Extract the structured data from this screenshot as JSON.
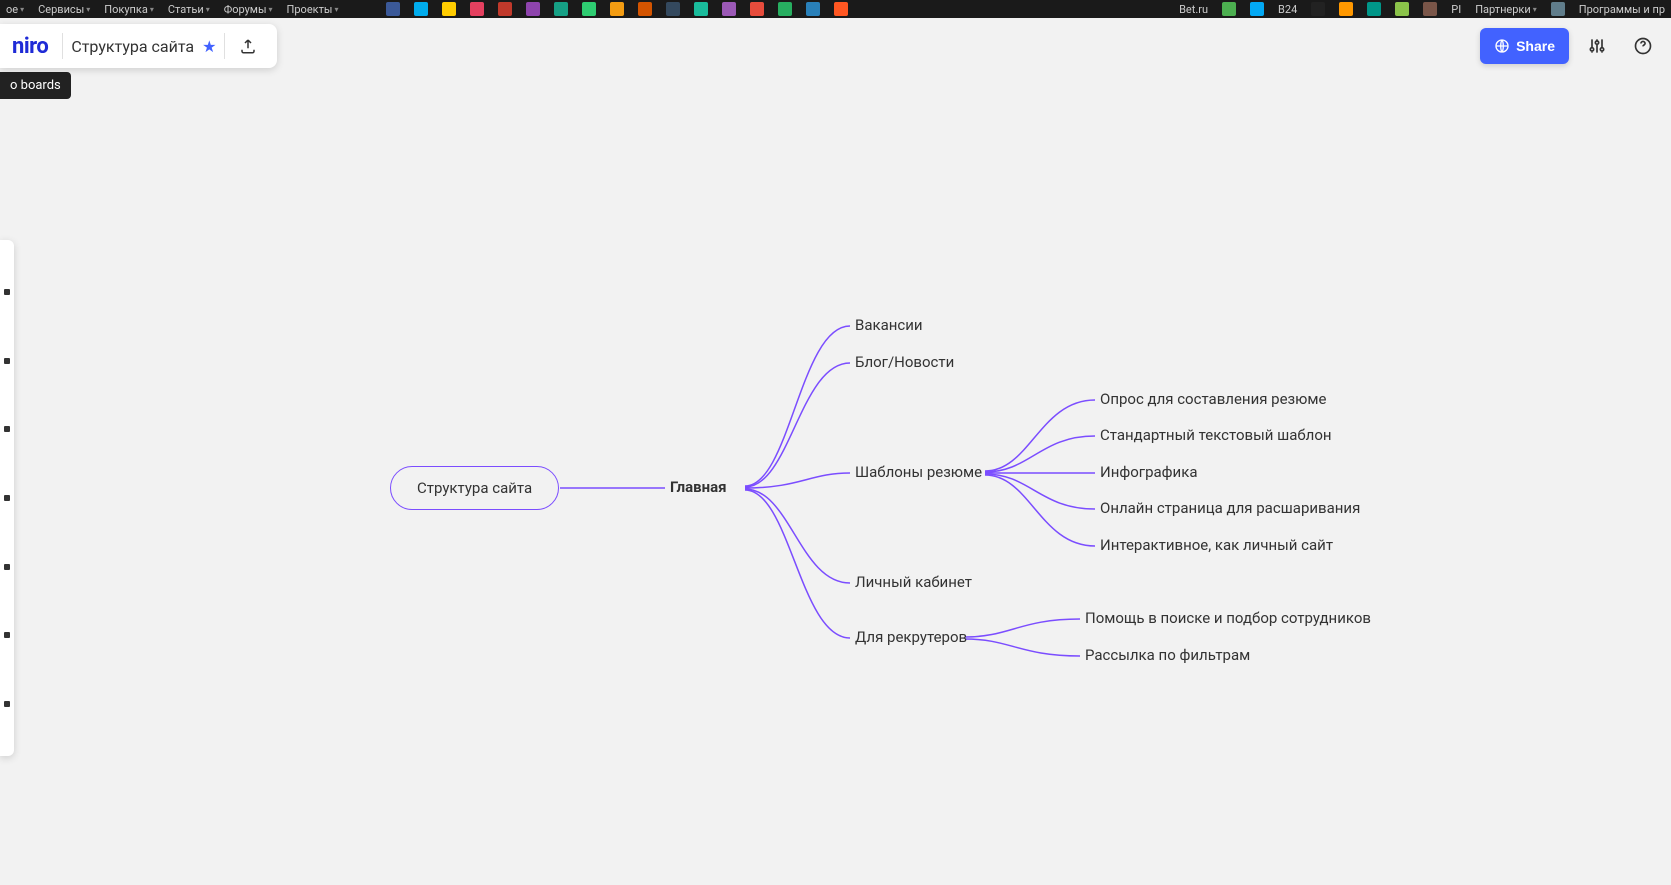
{
  "browser_bookmarks": [
    "ое",
    "Сервисы",
    "Покупка",
    "Статьи",
    "Форумы",
    "Проекты"
  ],
  "browser_bookmarks_right": [
    "Bet.ru",
    "B24",
    "PI",
    "Партнерки",
    "Программы и пр"
  ],
  "logo_text": "niro",
  "board_title": "Структура сайта",
  "tooltip_text": "o boards",
  "share_label": "Share",
  "mindmap": {
    "root": "Структура сайта",
    "hub": "Главная",
    "branches": [
      {
        "label": "Вакансии",
        "children": []
      },
      {
        "label": "Блог/Новости",
        "children": []
      },
      {
        "label": "Шаблоны резюме",
        "children": [
          "Опрос для составления резюме",
          "Стандартный текстовый шаблон",
          "Инфографика",
          "Онлайн страница для расшаривания",
          "Интерактивное, как личный сайт"
        ]
      },
      {
        "label": "Личный кабинет",
        "children": []
      },
      {
        "label": "Для рекрутеров",
        "children": [
          "Помощь в поиске и подбор сотрудников",
          "Рассылка по фильтрам"
        ]
      }
    ]
  }
}
